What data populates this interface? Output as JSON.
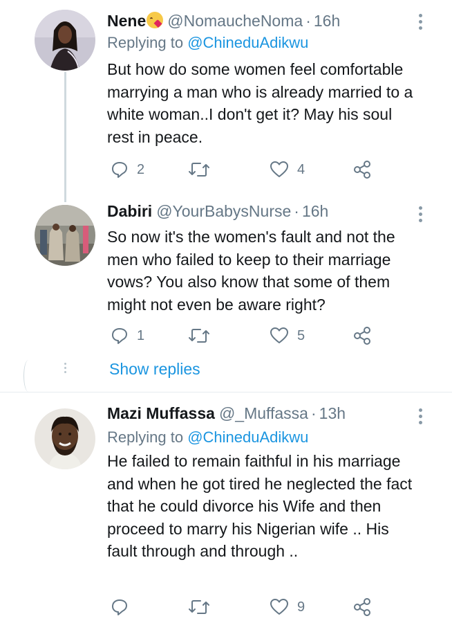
{
  "tweets": [
    {
      "name": "Nene",
      "handle": "@NomaucheNoma",
      "separator": "·",
      "time": "16h",
      "replying_prefix": "Replying to ",
      "replying_to": "@ChineduAdikwu",
      "text": "But how do some women feel comfortable marrying a man who is already married to a white woman..I don't get it? May his soul rest in peace.",
      "reply_count": "2",
      "retweet_count": "",
      "like_count": "4"
    },
    {
      "name": "Dabiri",
      "handle": "@YourBabysNurse",
      "separator": "·",
      "time": "16h",
      "text": "So now it's the women's fault and not the men who failed to keep to their marriage vows? You also know that some of them might not even be aware right?",
      "reply_count": "1",
      "retweet_count": "",
      "like_count": "5"
    },
    {
      "name": "Mazi Muffassa",
      "handle": "@_Muffassa",
      "separator": "·",
      "time": "13h",
      "replying_prefix": "Replying to ",
      "replying_to": "@ChineduAdikwu",
      "text": "He failed to remain faithful in his marriage and when he got tired he neglected the fact that he could divorce his Wife and then proceed to marry his Nigerian wife .. His fault through and through ..",
      "reply_count": "",
      "retweet_count": "",
      "like_count": "9"
    }
  ],
  "show_replies_label": "Show replies",
  "icons": {
    "reply": "reply-icon",
    "retweet": "retweet-icon",
    "like": "like-icon",
    "share": "share-icon",
    "more": "more-vertical-icon"
  },
  "colors": {
    "link": "#1b95e0",
    "secondary": "#657786",
    "text": "#14171a",
    "thread_line": "#cfd9de"
  }
}
